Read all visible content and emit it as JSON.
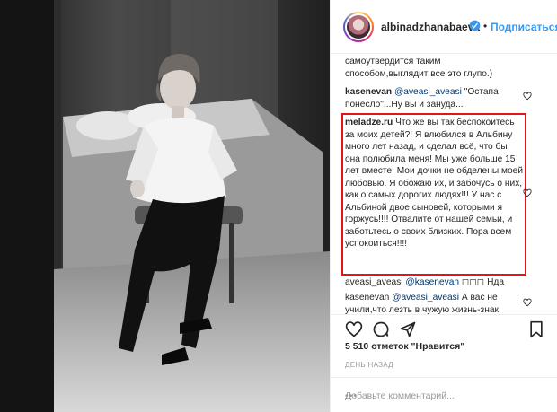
{
  "post": {
    "username": "albinadzhanabaeva",
    "follow_label": "Подписаться",
    "separator": "•",
    "likes_count": "5 510",
    "likes_text": "отметок \"Нравится\"",
    "time": "ДЕНЬ НАЗАД",
    "add_comment_placeholder": "Добавьте комментарий...",
    "more_label": "•••"
  },
  "comments": [
    {
      "user": "",
      "mention": "",
      "text": "самоутвердится таким способом,выглядит все это глупо.)"
    },
    {
      "user": "kasenevan",
      "mention": "@aveasi_aveasi",
      "text": "\"Остапа понесло\"...Ну вы и зануда..."
    },
    {
      "user": "meladze.ru",
      "mention": "",
      "text": "Что же вы так беспокоитесь за моих детей?! Я влюбился в Альбину много лет назад, и сделал всё, что бы она полюбила меня! Мы уже больше 15 лет вместе. Мои дочки не обделены моей любовью. Я обожаю их, и забочусь о них, как о самых дорогих людях!!! У нас с Альбиной двое сыновей, которыми я горжусь!!!! Отвалите от нашей семьи, и заботьтесь о своих близких. Пора всем успокоиться!!!!"
    },
    {
      "user": "aveasi_aveasi",
      "mention": "@kasenevan",
      "text": "◻◻◻ Нда"
    },
    {
      "user": "kasenevan",
      "mention": "@aveasi_aveasi",
      "text": "А вас не учили,что лезть в чужую жизнь-знак"
    }
  ],
  "colors": {
    "accent": "#3897f0",
    "highlight": "#e3151a",
    "mention": "#003569"
  },
  "icons": [
    "verified-icon",
    "heart-icon",
    "comment-icon",
    "share-icon",
    "bookmark-icon"
  ]
}
